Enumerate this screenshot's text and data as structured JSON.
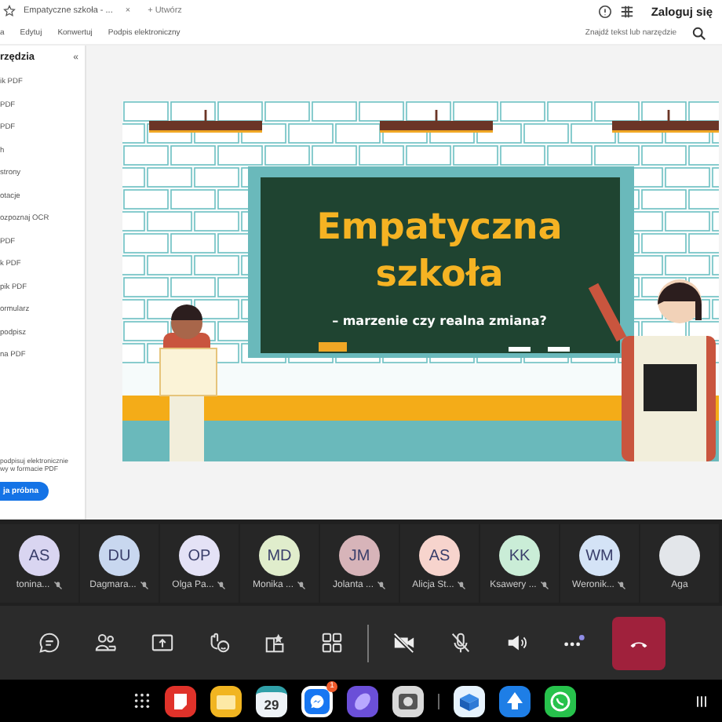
{
  "browser": {
    "tab_title": "Empatyczne szkoła - ...",
    "tab_close": "×",
    "new_tab": "+ Utwórz",
    "account": "Zaloguj się"
  },
  "menu": {
    "items": [
      "a",
      "Edytuj",
      "Konwertuj",
      "Podpis elektroniczny"
    ],
    "search": "Znajdź tekst lub narzędzie"
  },
  "sidebar": {
    "title": "rzędzia",
    "collapse": "«",
    "items": [
      "ik PDF",
      "PDF",
      "PDF",
      "h",
      "strony",
      "otacje",
      "ozpoznaj OCR",
      "PDF",
      "k PDF",
      "pik PDF",
      "ormularz",
      "podpisz",
      "na PDF"
    ],
    "promo": [
      "podpisuj elektronicznie",
      "wy w formacie PDF"
    ],
    "button": "ja próbna"
  },
  "slide": {
    "title_lines": [
      "Empatyczna",
      "szkoła"
    ],
    "subtitle": "– marzenie czy realna zmiana?"
  },
  "participants": [
    {
      "initials": "AS",
      "name": "tonina...",
      "color": "#d9d5f1"
    },
    {
      "initials": "DU",
      "name": "Dagmara...",
      "color": "#c8d7ef"
    },
    {
      "initials": "OP",
      "name": "Olga Pa...",
      "color": "#e4e2f6"
    },
    {
      "initials": "MD",
      "name": "Monika ...",
      "color": "#e0edcc"
    },
    {
      "initials": "JM",
      "name": "Jolanta ...",
      "color": "#d7b4b9"
    },
    {
      "initials": "AS",
      "name": "Alicja St...",
      "color": "#f7d4cd"
    },
    {
      "initials": "KK",
      "name": "Ksawery ...",
      "color": "#caedd7"
    },
    {
      "initials": "WM",
      "name": "Weronik...",
      "color": "#d4e3f6"
    },
    {
      "name": "Aga",
      "color": "#e3e6ea"
    }
  ],
  "taskbar": {
    "calendar_day": "29",
    "messenger_badge": "1"
  }
}
